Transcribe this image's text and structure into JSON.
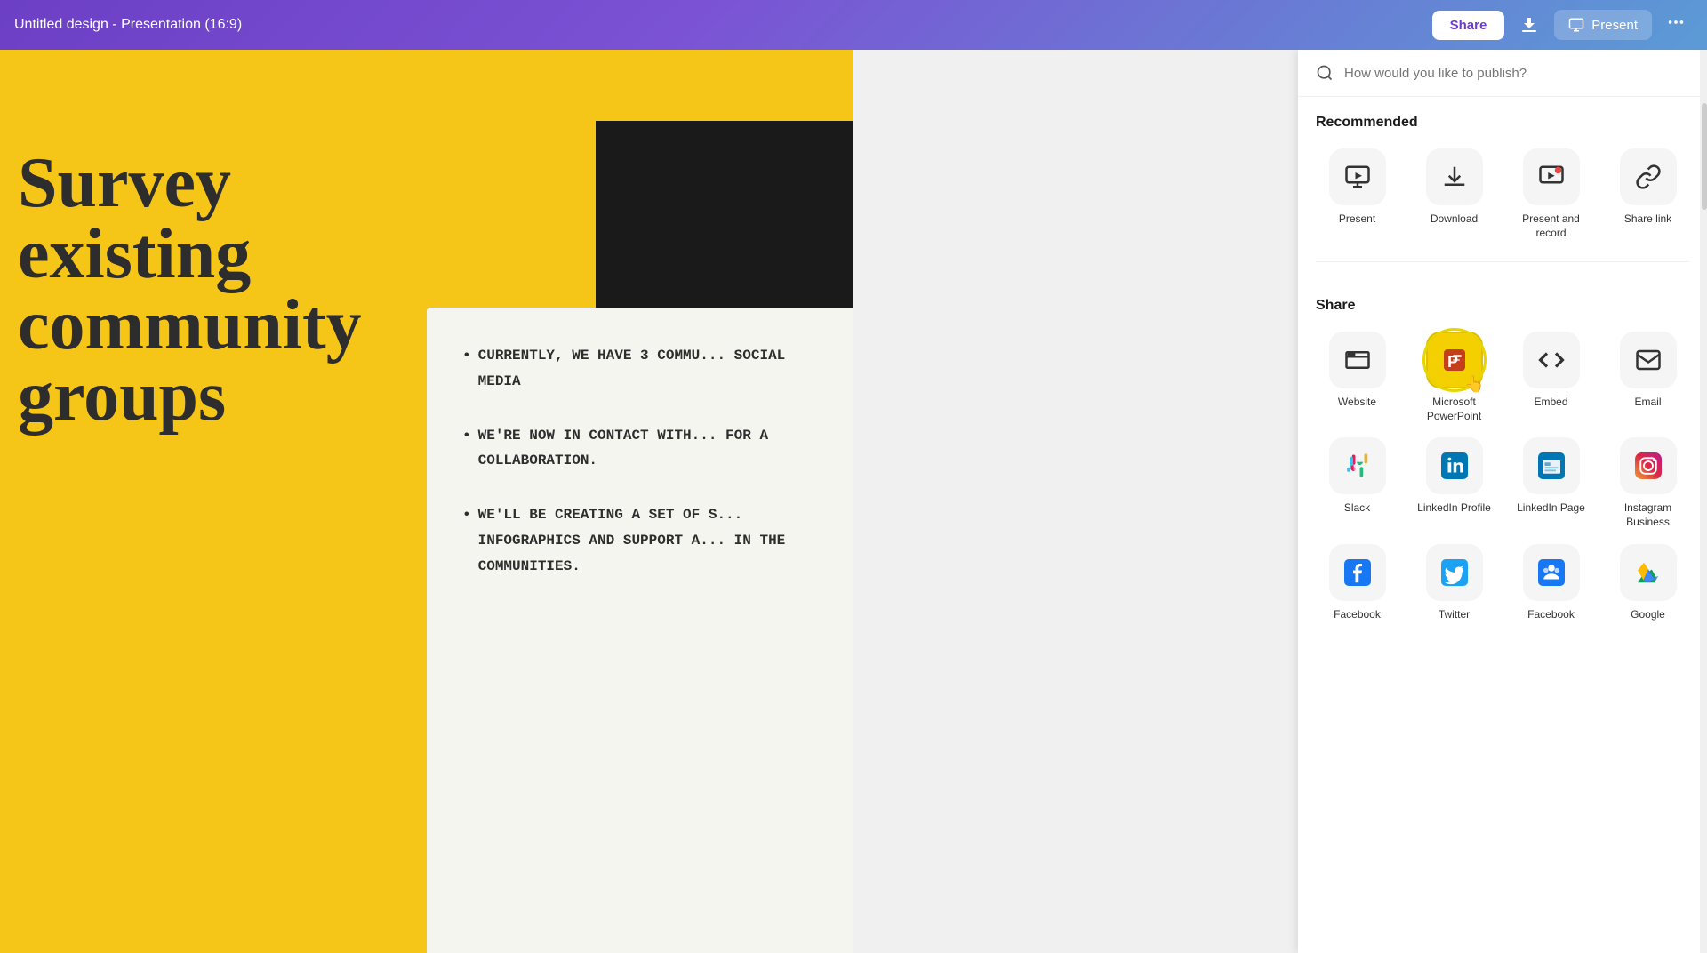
{
  "topbar": {
    "title": "Untitled design - Presentation (16:9)",
    "share_label": "Share",
    "download_icon": "⬇",
    "present_label": "Present",
    "more_icon": "···"
  },
  "slide": {
    "title_line1": "Survey",
    "title_line2": "existing",
    "title_line3": "community",
    "title_line4": "groups",
    "bullet1": "CURRENTLY, WE HAVE 3 COMMU... SOCIAL MEDIA",
    "bullet2": "WE'RE NOW IN CONTACT WITH... FOR A COLLABORATION.",
    "bullet3": "WE'LL BE CREATING A SET OF S... INFOGRAPHICS AND SUPPORT A... IN THE COMMUNITIES."
  },
  "panel": {
    "search_placeholder": "How would you like to publish?",
    "recommended_label": "Recommended",
    "share_label": "Share",
    "icons_recommended": [
      {
        "label": "Present",
        "icon": "present"
      },
      {
        "label": "Download",
        "icon": "download"
      },
      {
        "label": "Present and record",
        "icon": "present-record"
      },
      {
        "label": "Share link",
        "icon": "share-link"
      }
    ],
    "icons_share": [
      {
        "label": "Website",
        "icon": "website"
      },
      {
        "label": "Microsoft PowerPoint",
        "icon": "ppt",
        "highlighted": true
      },
      {
        "label": "Embed",
        "icon": "embed"
      },
      {
        "label": "Email",
        "icon": "email"
      },
      {
        "label": "Slack",
        "icon": "slack"
      },
      {
        "label": "LinkedIn Profile",
        "icon": "linkedin-profile"
      },
      {
        "label": "LinkedIn Page",
        "icon": "linkedin-page"
      },
      {
        "label": "Instagram Business",
        "icon": "instagram"
      },
      {
        "label": "Facebook",
        "icon": "facebook"
      },
      {
        "label": "Twitter",
        "icon": "twitter"
      },
      {
        "label": "Facebook",
        "icon": "facebook2"
      },
      {
        "label": "Google",
        "icon": "google-drive"
      }
    ]
  }
}
